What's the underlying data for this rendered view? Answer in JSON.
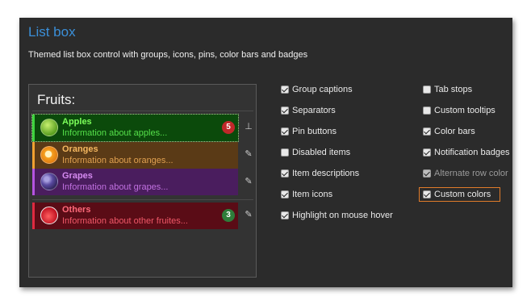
{
  "header": {
    "title": "List box",
    "subtitle": "Themed list box control with groups, icons, pins, color bars and badges"
  },
  "listbox": {
    "caption": "Fruits:",
    "items": [
      {
        "name": "Apples",
        "description": "Information about apples...",
        "badge": "5",
        "pin": "pinned",
        "bg": "#0b4a0b",
        "bar": "#3fd43f",
        "name_color": "#7cff5a",
        "desc_color": "#55e04a",
        "badge_color": "#c0282a",
        "icon": "apple-icon"
      },
      {
        "name": "Oranges",
        "description": "Information about oranges...",
        "badge": "",
        "pin": "unpinned",
        "bg": "#5a3a16",
        "bar": "#f0a030",
        "name_color": "#f5b860",
        "desc_color": "#e0a050",
        "badge_color": "",
        "icon": "orange-icon"
      },
      {
        "name": "Grapes",
        "description": "Information about grapes...",
        "badge": "",
        "pin": "unpinned",
        "bg": "#4a1d5e",
        "bar": "#b454e0",
        "name_color": "#d58af0",
        "desc_color": "#c070e0",
        "badge_color": "",
        "icon": "grapes-icon"
      },
      {
        "name": "Others",
        "description": "Information about other fruites...",
        "badge": "3",
        "pin": "unpinned",
        "bg": "#5a0c16",
        "bar": "#e02a40",
        "name_color": "#ff6a7a",
        "desc_color": "#f05868",
        "badge_color": "#2e7d3a",
        "icon": "strawberry-icon"
      }
    ]
  },
  "options": {
    "col1": [
      {
        "label": "Group captions",
        "checked": true
      },
      {
        "label": "Separators",
        "checked": true
      },
      {
        "label": "Pin buttons",
        "checked": true
      },
      {
        "label": "Disabled items",
        "checked": false
      },
      {
        "label": "Item descriptions",
        "checked": true
      },
      {
        "label": "Item icons",
        "checked": true
      },
      {
        "label": "Highlight on mouse hover",
        "checked": true
      }
    ],
    "col2": [
      {
        "label": "Tab stops",
        "checked": false
      },
      {
        "label": "Custom tooltips",
        "checked": false
      },
      {
        "label": "Color bars",
        "checked": true
      },
      {
        "label": "Notification badges",
        "checked": true
      },
      {
        "label": "Alternate row color",
        "checked": true,
        "disabled": true
      },
      {
        "label": "Custom colors",
        "checked": true,
        "focused": true
      }
    ]
  }
}
